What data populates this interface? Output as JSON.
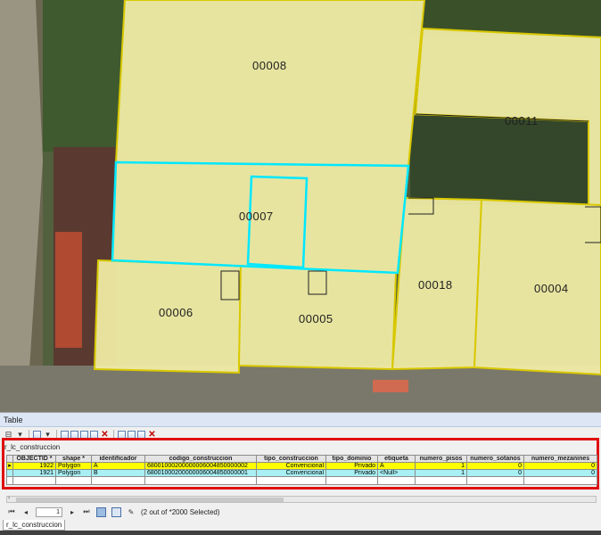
{
  "map": {
    "parcels": [
      {
        "id": "p08",
        "label": "00008"
      },
      {
        "id": "p11",
        "label": "00011"
      },
      {
        "id": "p07",
        "label": "00007"
      },
      {
        "id": "p18",
        "label": "00018"
      },
      {
        "id": "p04",
        "label": "00004"
      },
      {
        "id": "p06",
        "label": "00006"
      },
      {
        "id": "p05",
        "label": "00005"
      }
    ],
    "colors": {
      "fill": "#f4f0a8",
      "outline": "#e0d000",
      "selection": "#00e8ff",
      "feature_edge": "#202020"
    }
  },
  "table": {
    "window_title": "Table",
    "layer_name": "r_lc_construccion",
    "columns": [
      "OBJECTID *",
      "shape *",
      "identificador",
      "codigo_construccion",
      "tipo_construccion",
      "tipo_dominio",
      "etiqueta",
      "numero_pisos",
      "numero_sotanos",
      "numero_mezanines"
    ],
    "rows": [
      [
        "1922",
        "Polygon",
        "A",
        "68001000200000006004850000002",
        "Convencional",
        "Privado",
        "A",
        "1",
        "0",
        "0"
      ],
      [
        "1921",
        "Polygon",
        "B",
        "68001000200000006004850000001",
        "Convencional",
        "Privado",
        "<Null>",
        "1",
        "0",
        "0"
      ]
    ],
    "nav": {
      "current_record": "1",
      "selection_text": "(2 out of *2000 Selected)"
    },
    "bottom_tab": "r_lc_construccion",
    "highlight_color": "#e01010"
  }
}
